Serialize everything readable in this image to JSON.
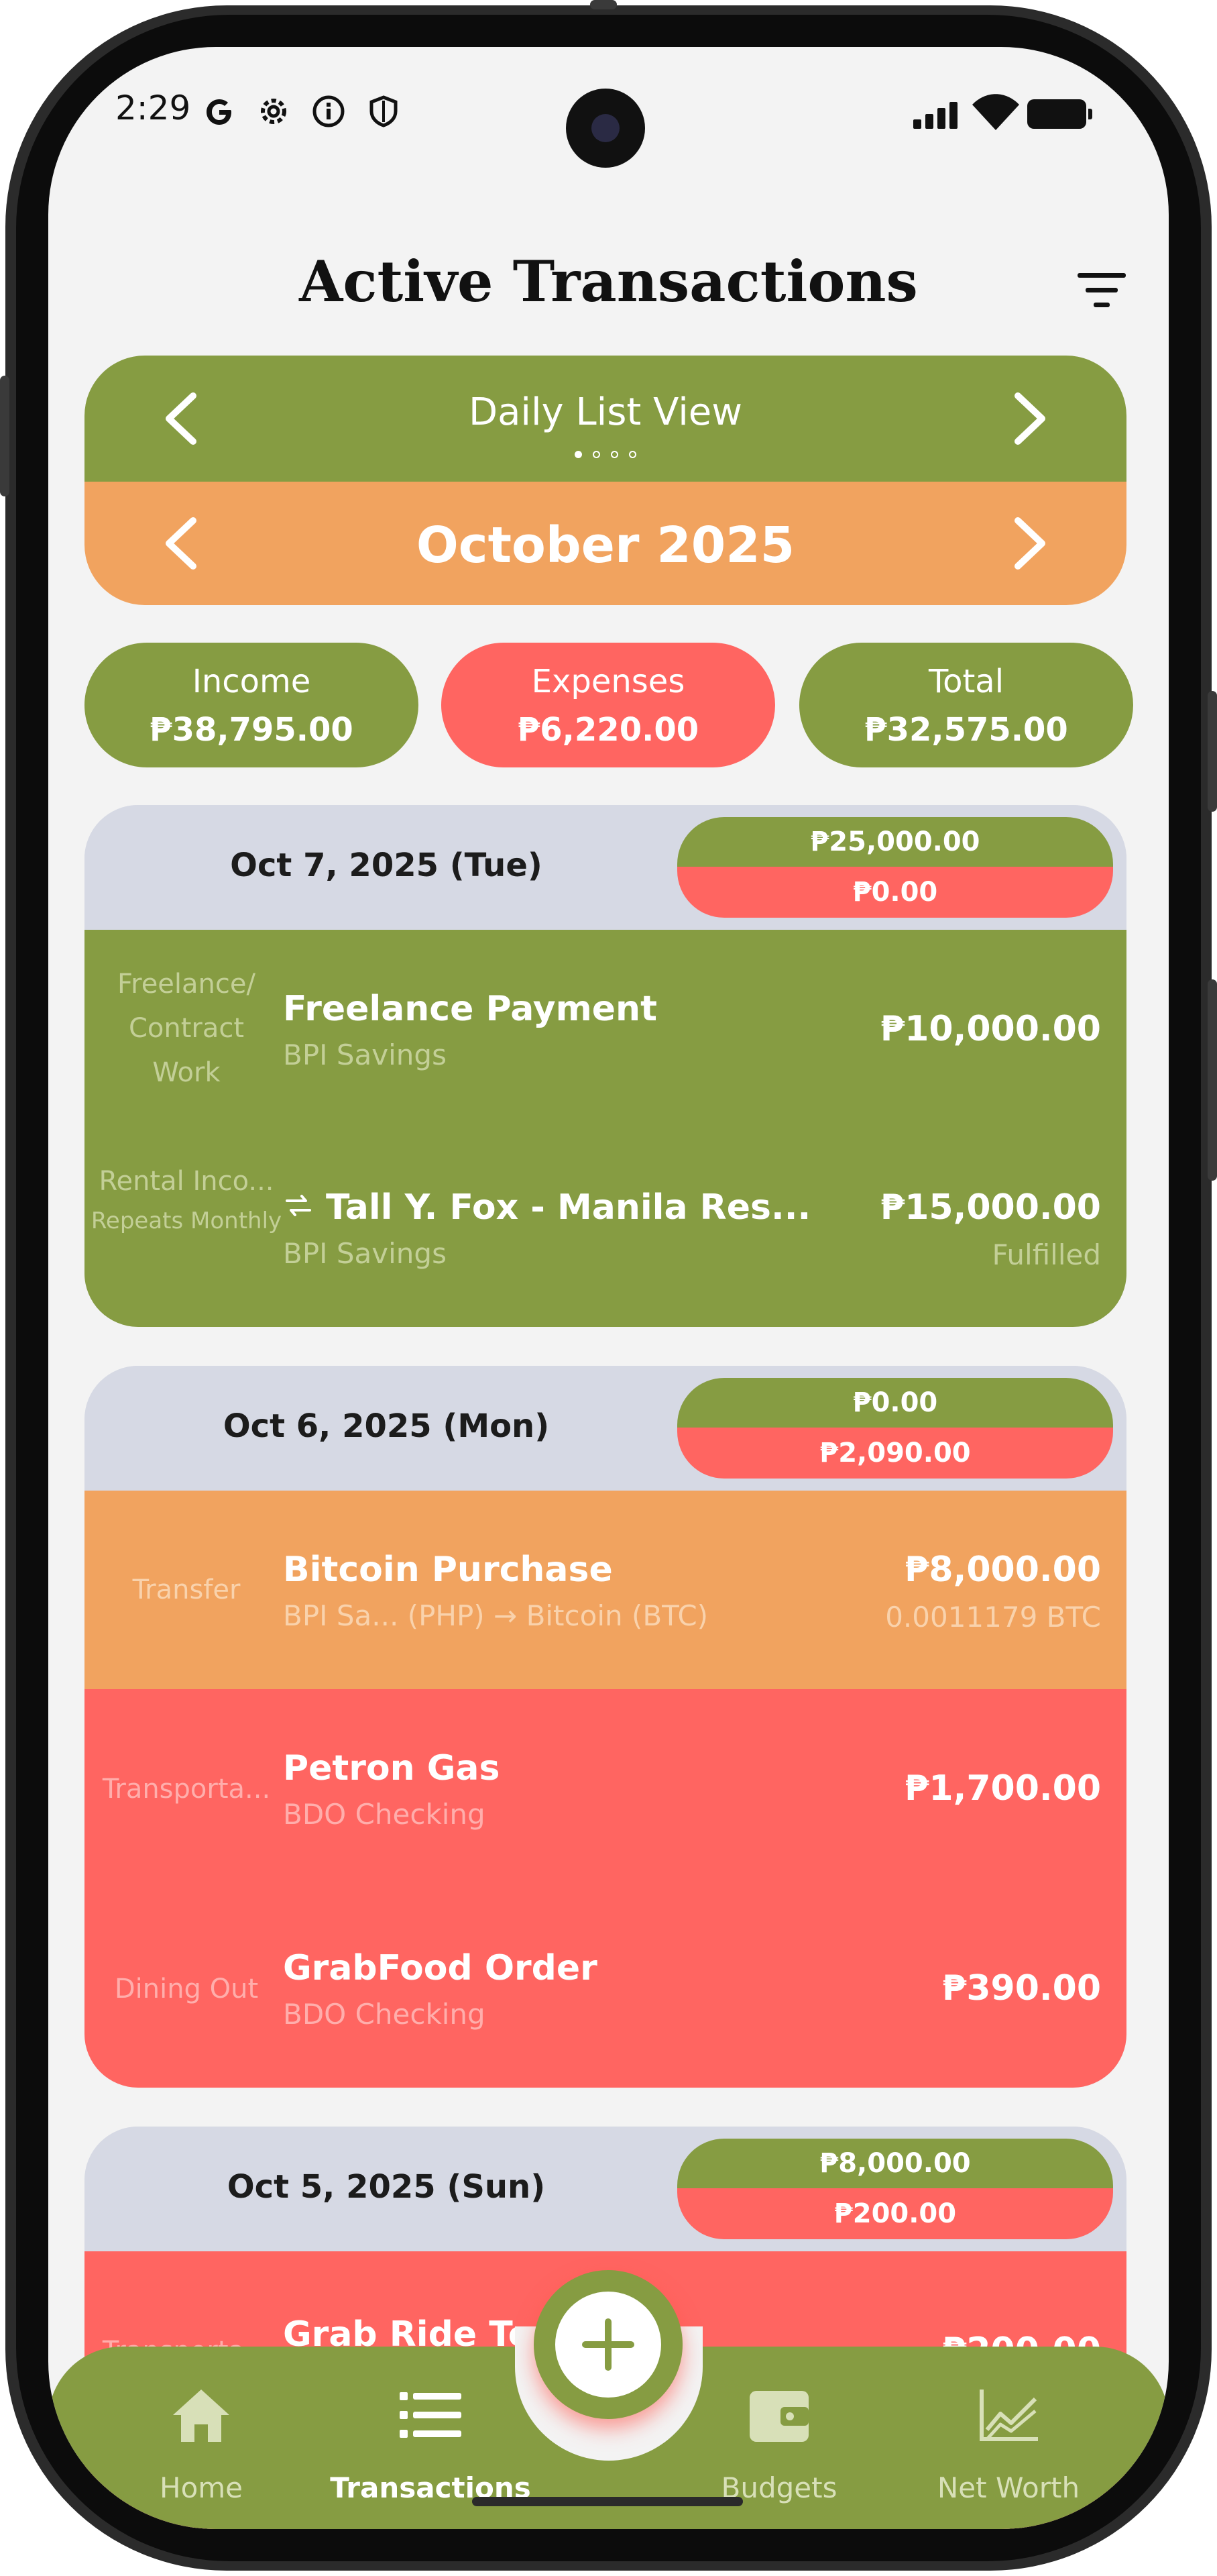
{
  "status_bar": {
    "time": "2:29"
  },
  "header": {
    "title": "Active Transactions"
  },
  "view_switcher": {
    "view_label": "Daily List View",
    "period_label": "October 2025",
    "page_count": 4,
    "active_page": 1
  },
  "summary": {
    "income": {
      "label": "Income",
      "value": "₱38,795.00"
    },
    "expenses": {
      "label": "Expenses",
      "value": "₱6,220.00"
    },
    "total": {
      "label": "Total",
      "value": "₱32,575.00"
    }
  },
  "days": [
    {
      "date": "Oct 7, 2025 (Tue)",
      "income_total": "₱25,000.00",
      "expense_total": "₱0.00",
      "transactions": [
        {
          "category": "Freelance/ Contract Work",
          "note": "",
          "name": "Freelance Payment",
          "account": "BPI Savings",
          "amount": "₱10,000.00",
          "sub": "",
          "kind": "income",
          "repeat": false
        },
        {
          "category": "Rental Inco...",
          "note": "Repeats Monthly",
          "name": "Tall Y. Fox - Manila Res...",
          "account": "BPI Savings",
          "amount": "₱15,000.00",
          "sub": "Fulfilled",
          "kind": "income",
          "repeat": true
        }
      ]
    },
    {
      "date": "Oct 6, 2025 (Mon)",
      "income_total": "₱0.00",
      "expense_total": "₱2,090.00",
      "transactions": [
        {
          "category": "Transfer",
          "note": "",
          "name": "Bitcoin Purchase",
          "account": "BPI Sa... (PHP) → Bitcoin (BTC)",
          "amount": "₱8,000.00",
          "sub": "0.0011179 BTC",
          "kind": "transfer",
          "repeat": false
        },
        {
          "category": "Transporta...",
          "note": "",
          "name": "Petron Gas",
          "account": "BDO Checking",
          "amount": "₱1,700.00",
          "sub": "",
          "kind": "expense",
          "repeat": false
        },
        {
          "category": "Dining Out",
          "note": "",
          "name": "GrabFood Order",
          "account": "BDO Checking",
          "amount": "₱390.00",
          "sub": "",
          "kind": "expense",
          "repeat": false
        }
      ]
    },
    {
      "date": "Oct 5, 2025 (Sun)",
      "income_total": "₱8,000.00",
      "expense_total": "₱200.00",
      "transactions": [
        {
          "category": "Transporta...",
          "note": "",
          "name": "Grab Ride To Po",
          "account": "",
          "amount": "₱200.00",
          "sub": "",
          "kind": "expense",
          "repeat": false
        }
      ]
    }
  ],
  "nav": {
    "items": [
      {
        "label": "Home",
        "icon": "home-icon",
        "active": false
      },
      {
        "label": "Transactions",
        "icon": "list-icon",
        "active": true
      },
      {
        "label": "Budgets",
        "icon": "wallet-icon",
        "active": false
      },
      {
        "label": "Net Worth",
        "icon": "chart-line-icon",
        "active": false
      }
    ],
    "fab_icon": "plus-icon"
  },
  "colors": {
    "income": "#869c42",
    "expense": "#ff6561",
    "transfer": "#f1a35f",
    "day_header": "#d6d9e4"
  }
}
